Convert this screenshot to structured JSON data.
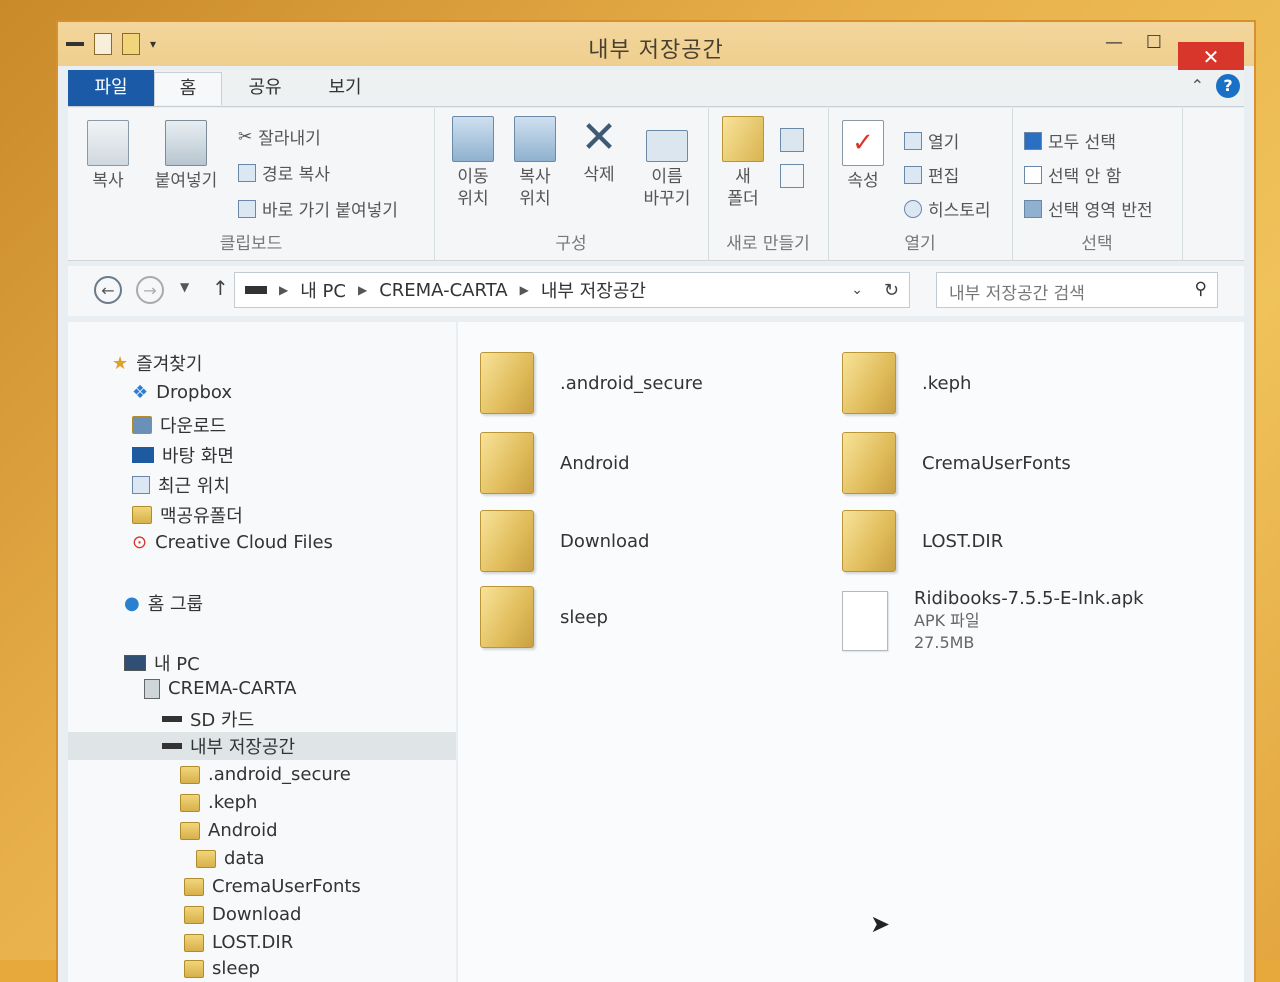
{
  "window": {
    "title": "내부 저장공간"
  },
  "controls": {
    "minimize": "—",
    "maximize": "☐",
    "close": "✕"
  },
  "tabs": [
    "파일",
    "홈",
    "공유",
    "보기"
  ],
  "ribbon": {
    "clipboard": {
      "copy": "복사",
      "paste": "붙여넣기",
      "cut": "잘라내기",
      "copy_path": "경로 복사",
      "paste_shortcut": "바로 가기 붙여넣기",
      "label": "클립보드"
    },
    "organize": {
      "move_line1": "이동",
      "move_line2": "위치",
      "copyto_line1": "복사",
      "copyto_line2": "위치",
      "delete": "삭제",
      "rename_line1": "이름",
      "rename_line2": "바꾸기",
      "label": "구성"
    },
    "new": {
      "new_line1": "새",
      "new_line2": "폴더",
      "label": "새로 만들기"
    },
    "open": {
      "properties": "속성",
      "open": "열기",
      "edit": "편집",
      "history": "히스토리",
      "label": "열기"
    },
    "select": {
      "select_all": "모두 선택",
      "select_none": "선택 안 함",
      "invert": "선택 영역 반전",
      "label": "선택"
    }
  },
  "address": {
    "crumbs": [
      "내 PC",
      "CREMA-CARTA",
      "내부 저장공간"
    ],
    "search_placeholder": "내부 저장공간 검색"
  },
  "nav": {
    "favorites": "즐겨찾기",
    "items": [
      "Dropbox",
      "다운로드",
      "바탕 화면",
      "최근 위치",
      "맥공유폴더",
      "Creative Cloud Files"
    ],
    "homegroup": "홈 그룹",
    "pc": "내 PC",
    "device": "CREMA-CARTA",
    "sd": "SD 카드",
    "internal": "내부 저장공간",
    "sub": [
      ".android_secure",
      ".keph",
      "Android",
      "data",
      "CremaUserFonts",
      "Download",
      "LOST.DIR",
      "sleep"
    ]
  },
  "files": [
    {
      "name": ".android_secure"
    },
    {
      "name": ".keph"
    },
    {
      "name": "Android"
    },
    {
      "name": "CremaUserFonts"
    },
    {
      "name": "Download"
    },
    {
      "name": "LOST.DIR"
    },
    {
      "name": "sleep"
    },
    {
      "name": "Ridibooks-7.5.5-E-Ink.apk",
      "type": "APK 파일",
      "size": "27.5MB"
    }
  ]
}
